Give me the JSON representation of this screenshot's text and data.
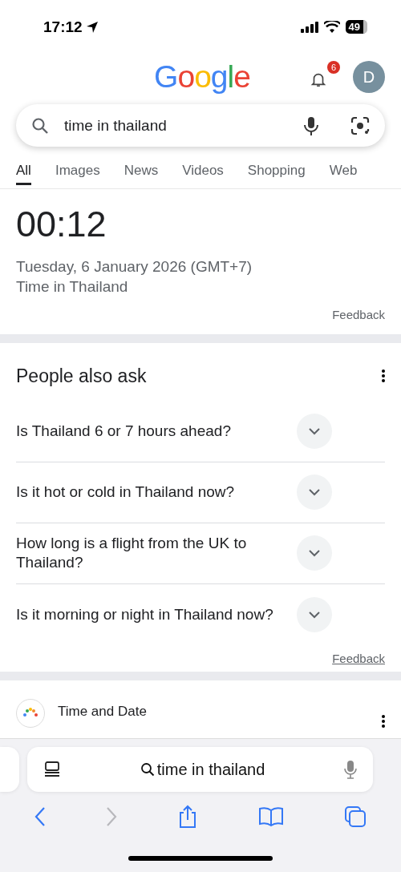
{
  "status_bar": {
    "time": "17:12",
    "battery": "49"
  },
  "header": {
    "logo": "Google",
    "notifications": "6",
    "avatar": "D"
  },
  "search": {
    "value": "time in thailand"
  },
  "tabs": [
    {
      "label": "All",
      "selected": true
    },
    {
      "label": "Images",
      "selected": false
    },
    {
      "label": "News",
      "selected": false
    },
    {
      "label": "Videos",
      "selected": false
    },
    {
      "label": "Shopping",
      "selected": false
    },
    {
      "label": "Web",
      "selected": false
    }
  ],
  "time_card": {
    "time": "00:12",
    "date": "Tuesday, 6 January 2026 (GMT+7)",
    "caption": "Time in Thailand",
    "feedback": "Feedback"
  },
  "people_also_ask": {
    "title": "People also ask",
    "questions": [
      {
        "text": "Is Thailand 6 or 7 hours ahead?",
        "expanded": false
      },
      {
        "text": "Is it hot or cold in Thailand now?",
        "expanded": false
      },
      {
        "text": "How long is a flight from the UK to Thailand?",
        "expanded": false
      },
      {
        "text": "Is it morning or night in Thailand now?",
        "expanded": false
      }
    ],
    "feedback": "Feedback"
  },
  "result": {
    "site": "Time and Date"
  },
  "browser_bar": {
    "address": "time in thailand",
    "back_enabled": true,
    "forward_enabled": false
  }
}
